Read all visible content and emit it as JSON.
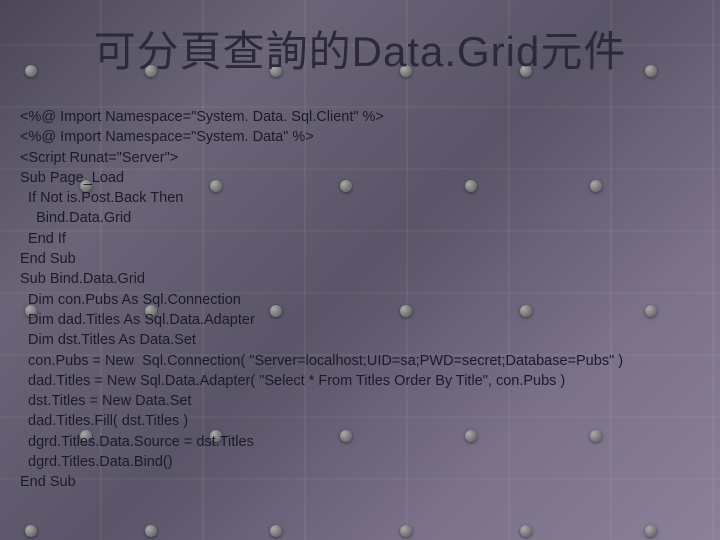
{
  "title": "可分頁查詢的Data.Grid元件",
  "code": {
    "l1": "<%@ Import Namespace=\"System. Data. Sql.Client\" %>",
    "l2": "<%@ Import Namespace=\"System. Data\" %>",
    "l3": "<Script Runat=\"Server\">",
    "l4": "Sub Page_Load",
    "l5": "  If Not is.Post.Back Then",
    "l6": "    Bind.Data.Grid",
    "l7": "  End If",
    "l8": "End Sub",
    "l9": "Sub Bind.Data.Grid",
    "l10": "  Dim con.Pubs As Sql.Connection",
    "l11": "  Dim dad.Titles As Sql.Data.Adapter",
    "l12": "  Dim dst.Titles As Data.Set",
    "l13": "  con.Pubs = New  Sql.Connection( \"Server=localhost;UID=sa;PWD=secret;Database=Pubs\" )",
    "l14": "  dad.Titles = New Sql.Data.Adapter( \"Select * From Titles Order By Title\", con.Pubs )",
    "l15": "  dst.Titles = New Data.Set",
    "l16": "  dad.Titles.Fill( dst.Titles )",
    "l17": "  dgrd.Titles.Data.Source = dst.Titles",
    "l18": "  dgrd.Titles.Data.Bind()",
    "l19": "End Sub"
  }
}
